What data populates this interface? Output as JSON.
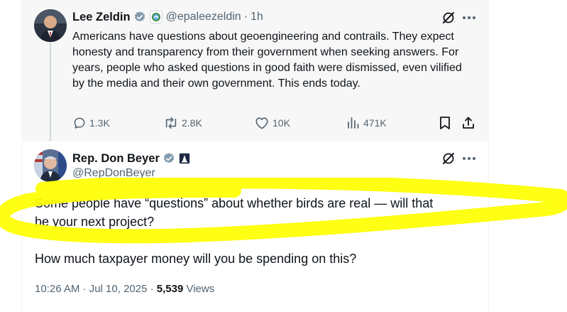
{
  "quoted": {
    "name": "Lee Zeldin",
    "handle": "@epaleezeldin",
    "sep": "·",
    "time": "1h",
    "text": "Americans have questions about geoengineering and contrails. They expect honesty and transparency from their government when seeking answers. For years, people who asked questions in good faith were dismissed, even vilified by the media and their own government. This ends today.",
    "stats": {
      "replies": "1.3K",
      "reposts": "2.8K",
      "likes": "10K",
      "views": "471K"
    }
  },
  "main": {
    "name": "Rep. Don Beyer",
    "handle": "@RepDonBeyer",
    "text_line1": "Some people have “questions” about whether birds are real — will that",
    "text_line2": "be your next project?",
    "text_para2": "How much taxpayer money will you be spending on this?",
    "time": "10:26 AM · Jul 10, 2025 · ",
    "views_count": "5,539",
    "views_label": " Views"
  },
  "colors": {
    "verified_gray": "#829aab",
    "highlight": "#ffff00",
    "muted_text": "#536471",
    "quoted_bg": "#f7f7f7"
  },
  "icons": {
    "verified": "verified-badge-icon",
    "grok": "grok-icon",
    "more": "more-icon",
    "reply": "reply-icon",
    "repost": "repost-icon",
    "like": "like-icon",
    "views": "views-icon",
    "bookmark": "bookmark-icon",
    "share": "share-icon"
  }
}
